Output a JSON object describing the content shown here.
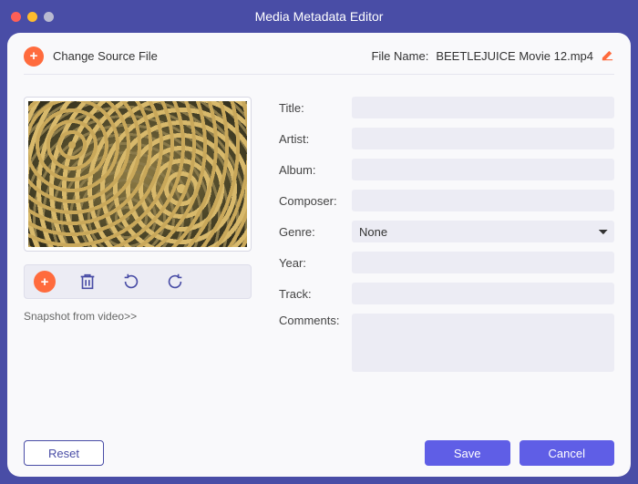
{
  "app_title": "Media Metadata Editor",
  "topbar": {
    "change_source": "Change Source File",
    "filename_label": "File Name:",
    "filename_value": "BEETLEJUICE Movie 12.mp4"
  },
  "snapshot_link": "Snapshot from video>>",
  "form": {
    "title": {
      "label": "Title:",
      "value": ""
    },
    "artist": {
      "label": "Artist:",
      "value": ""
    },
    "album": {
      "label": "Album:",
      "value": ""
    },
    "composer": {
      "label": "Composer:",
      "value": ""
    },
    "genre": {
      "label": "Genre:",
      "value": "None"
    },
    "year": {
      "label": "Year:",
      "value": ""
    },
    "track": {
      "label": "Track:",
      "value": ""
    },
    "comments": {
      "label": "Comments:",
      "value": ""
    }
  },
  "footer": {
    "reset": "Reset",
    "save": "Save",
    "cancel": "Cancel"
  },
  "icons": {
    "plus": "+",
    "trash": "trash-icon",
    "rotate_left": "rotate-left-icon",
    "rotate_right": "rotate-right-icon",
    "pencil": "pencil-icon"
  }
}
